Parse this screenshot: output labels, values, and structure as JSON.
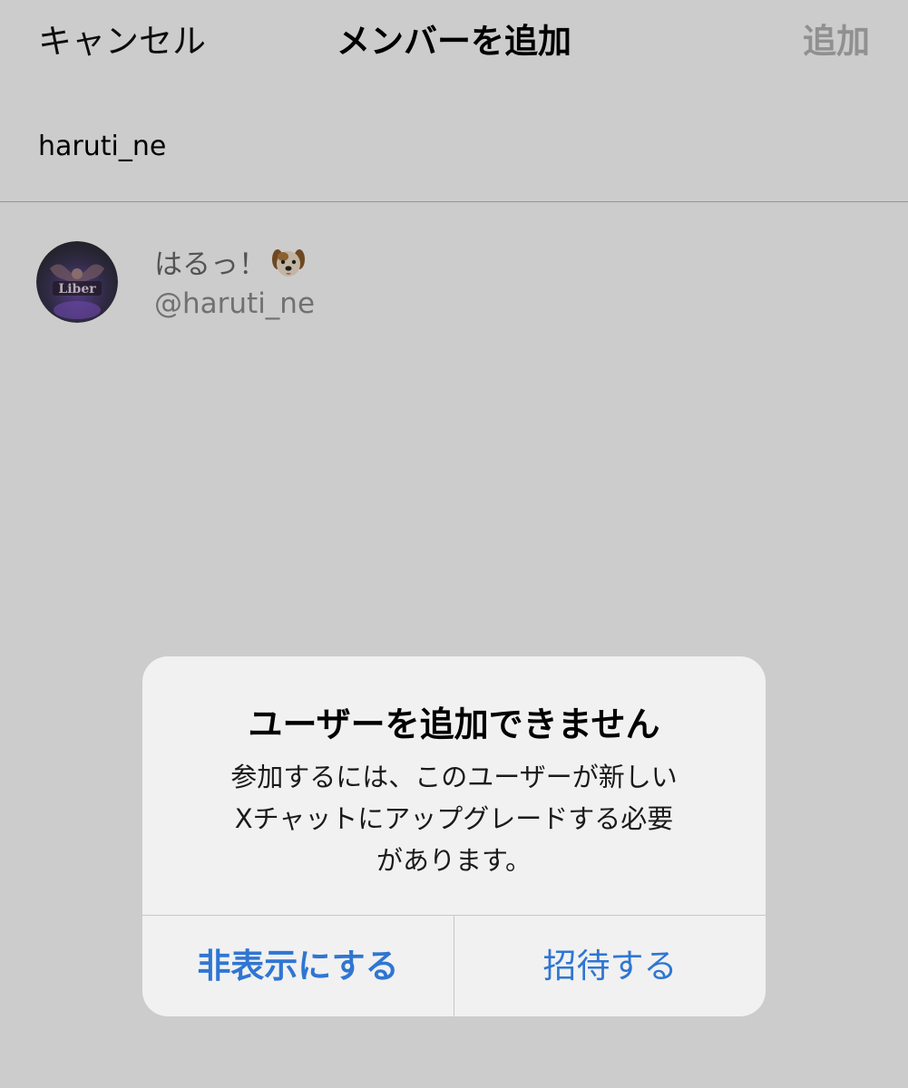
{
  "nav": {
    "cancel_label": "キャンセル",
    "title": "メンバーを追加",
    "add_label": "追加"
  },
  "search": {
    "value": "haruti_ne"
  },
  "result": {
    "display_name": "はるっ！",
    "handle": "@haruti_ne",
    "name_emoji_icon": "dog-face-icon",
    "avatar_logo_text": "Liber"
  },
  "alert": {
    "title": "ユーザーを追加できません",
    "message_line1": "参加するには、このユーザーが新しい",
    "message_line2": "Xチャットにアップグレードする必要",
    "message_line3": "があります。",
    "hide_label": "非表示にする",
    "invite_label": "招待する"
  },
  "colors": {
    "background": "#ffffff",
    "dim_overlay": "rgba(0,0,0,0.2)",
    "alert_background": "#f1f1f1",
    "action_blue": "#2f76d2",
    "disabled_gray": "#b5b5b5"
  }
}
